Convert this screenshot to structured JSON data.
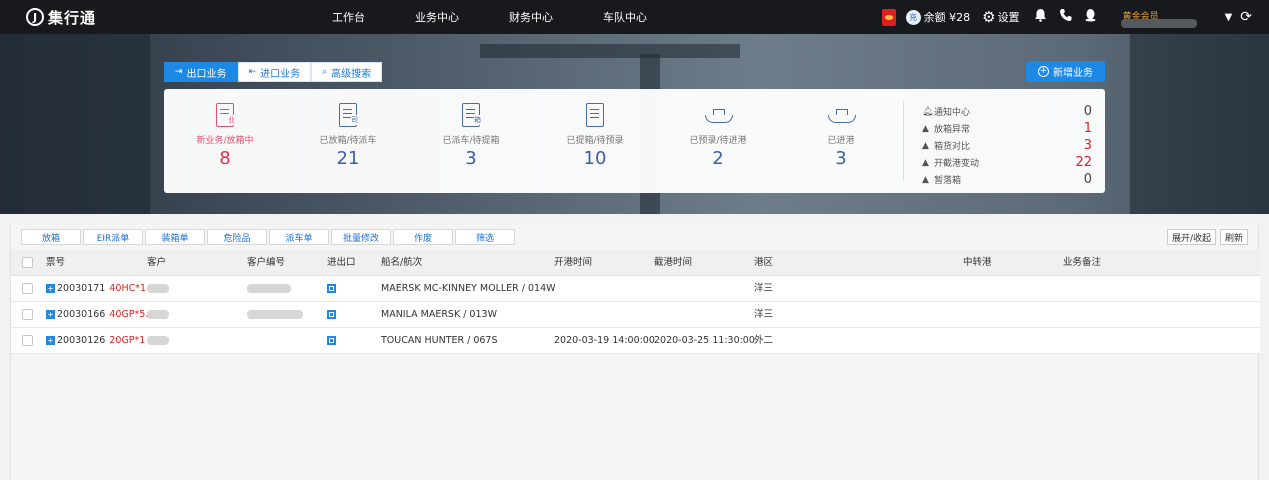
{
  "nav": {
    "logo_mark": "J",
    "logo_text": "集行通",
    "menu": [
      "工作台",
      "业务中心",
      "财务中心",
      "车队中心"
    ],
    "balance_icon_text": "充",
    "balance": "余额 ¥28",
    "settings": "设置",
    "member_tag": "黄金会员"
  },
  "banner": {
    "tabs": [
      {
        "label": "出口业务",
        "icon": "export-icon"
      },
      {
        "label": "进口业务",
        "icon": "import-icon"
      },
      {
        "label": "高级搜索",
        "icon": "search-icon"
      }
    ],
    "new_business": "新增业务",
    "stats": [
      {
        "label": "新业务/放箱中",
        "value": "8",
        "tag": "业"
      },
      {
        "label": "已放箱/待派车",
        "value": "21",
        "tag": "司"
      },
      {
        "label": "已派车/待提箱",
        "value": "3",
        "tag": "箱"
      },
      {
        "label": "已提箱/待预录",
        "value": "10",
        "tag": ""
      },
      {
        "label": "已预录/待进港",
        "value": "2",
        "tag": ""
      },
      {
        "label": "已进港",
        "value": "3",
        "tag": ""
      }
    ],
    "notices": [
      {
        "label": "通知中心",
        "value": "0"
      },
      {
        "label": "放箱异常",
        "value": "1"
      },
      {
        "label": "箱货对比",
        "value": "3"
      },
      {
        "label": "开截港变动",
        "value": "22"
      },
      {
        "label": "暂落箱",
        "value": "0"
      }
    ]
  },
  "toolbar": {
    "buttons": [
      "放箱",
      "EIR派单",
      "装箱单",
      "危险品",
      "派车单",
      "批量修改",
      "作废",
      "筛选"
    ],
    "expand_collapse": "展开/收起",
    "refresh": "刷新"
  },
  "table": {
    "headers": [
      "票号",
      "客户",
      "客户编号",
      "进出口",
      "船名/航次",
      "开港时间",
      "截港时间",
      "港区",
      "中转港",
      "业务备注"
    ],
    "rows": [
      {
        "ticket": "20030171",
        "ctype": "40HC*1",
        "vessel": "MAERSK MC-KINNEY MOLLER / 014W",
        "open": "",
        "close": "",
        "port": "洋三"
      },
      {
        "ticket": "20030166",
        "ctype": "40GP*5...",
        "vessel": "MANILA MAERSK / 013W",
        "open": "",
        "close": "",
        "port": "洋三"
      },
      {
        "ticket": "20030126",
        "ctype": "20GP*1",
        "vessel": "TOUCAN HUNTER / 067S",
        "open": "2020-03-19 14:00:00",
        "close": "2020-03-25 11:30:00",
        "port": "外二"
      }
    ]
  },
  "colors": {
    "accent": "#1e88e5",
    "danger": "#e02020",
    "topbar": "#17191d"
  }
}
